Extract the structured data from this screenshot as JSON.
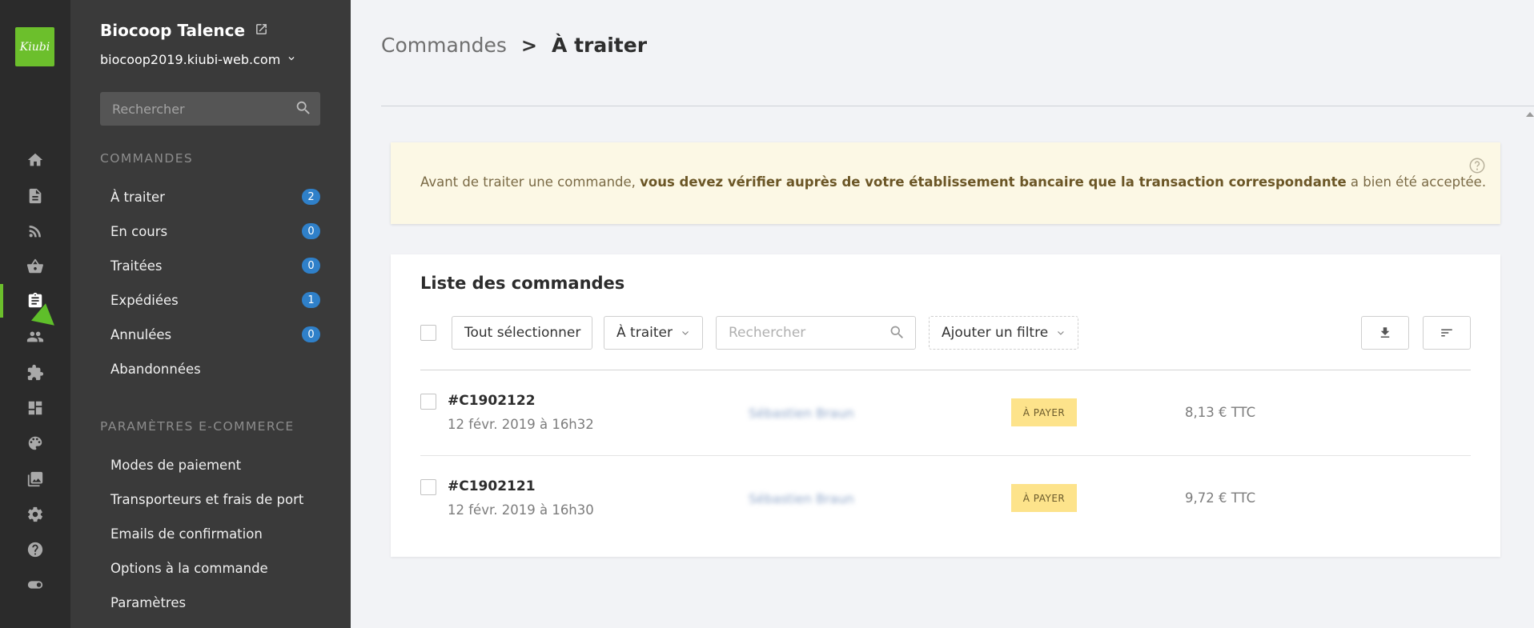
{
  "rail": {
    "logo_text": "Kiubi",
    "icons": [
      "home-icon",
      "document-icon",
      "rss-icon",
      "basket-icon",
      "clipboard-icon",
      "users-icon",
      "puzzle-icon",
      "layout-icon",
      "palette-icon",
      "images-icon",
      "gear-icon",
      "help-icon",
      "toggle-icon"
    ],
    "active_icon": "clipboard-icon",
    "accent_color": "#6cbf2c"
  },
  "sidebar": {
    "site_title": "Biocoop Talence",
    "site_domain": "biocoop2019.kiubi-web.com",
    "search_placeholder": "Rechercher",
    "section_orders": "COMMANDES",
    "order_items": [
      {
        "label": "À traiter",
        "count": "2"
      },
      {
        "label": "En cours",
        "count": "0"
      },
      {
        "label": "Traitées",
        "count": "0"
      },
      {
        "label": "Expédiées",
        "count": "1"
      },
      {
        "label": "Annulées",
        "count": "0"
      },
      {
        "label": "Abandonnées"
      }
    ],
    "section_settings": "PARAMÈTRES E-COMMERCE",
    "settings_items": [
      {
        "label": "Modes de paiement"
      },
      {
        "label": "Transporteurs et frais de port"
      },
      {
        "label": "Emails de confirmation"
      },
      {
        "label": "Options à la commande"
      },
      {
        "label": "Paramètres"
      }
    ]
  },
  "header": {
    "breadcrumb_parent": "Commandes",
    "breadcrumb_separator": ">",
    "breadcrumb_current": "À traiter"
  },
  "alert": {
    "text_before": "Avant de traiter une commande, ",
    "text_bold": "vous devez vérifier auprès de votre établissement bancaire que la transaction correspondante",
    "text_after": " a bien été acceptée."
  },
  "orders_panel": {
    "title": "Liste des commandes",
    "select_all_label": "Tout sélectionner",
    "status_filter_value": "À traiter",
    "search_placeholder": "Rechercher",
    "add_filter_label": "Ajouter un filtre",
    "rows": [
      {
        "id": "#C1902122",
        "date": "12 févr. 2019 à 16h32",
        "customer": "Sébastien Braun",
        "status": "À PAYER",
        "total": "8,13 € TTC"
      },
      {
        "id": "#C1902121",
        "date": "12 févr. 2019 à 16h30",
        "customer": "Sébastien Braun",
        "status": "À PAYER",
        "total": "9,72 € TTC"
      }
    ]
  }
}
